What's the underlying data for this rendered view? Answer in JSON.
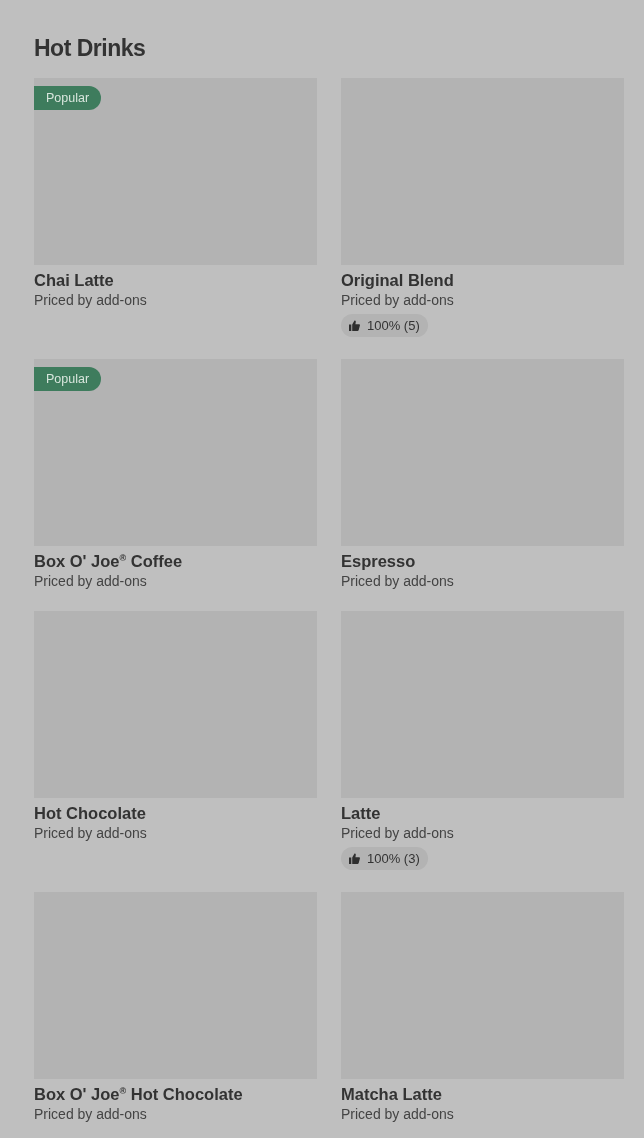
{
  "section": {
    "title": "Hot Drinks"
  },
  "items": [
    {
      "badge": "Popular",
      "name": "Chai Latte",
      "subtitle": "Priced by add-ons"
    },
    {
      "name": "Original Blend",
      "subtitle": "Priced by add-ons",
      "rating": "100% (5)"
    },
    {
      "badge": "Popular",
      "name": "Box O' Joe$^{®}$ Coffee",
      "subtitle": "Priced by add-ons"
    },
    {
      "name": "Espresso",
      "subtitle": "Priced by add-ons"
    },
    {
      "name": "Hot Chocolate",
      "subtitle": "Priced by add-ons"
    },
    {
      "name": "Latte",
      "subtitle": "Priced by add-ons",
      "rating": "100% (3)"
    },
    {
      "name": "Box O' Joe$^{®}$ Hot Chocolate",
      "subtitle": "Priced by add-ons"
    },
    {
      "name": "Matcha Latte",
      "subtitle": "Priced by add-ons"
    }
  ]
}
